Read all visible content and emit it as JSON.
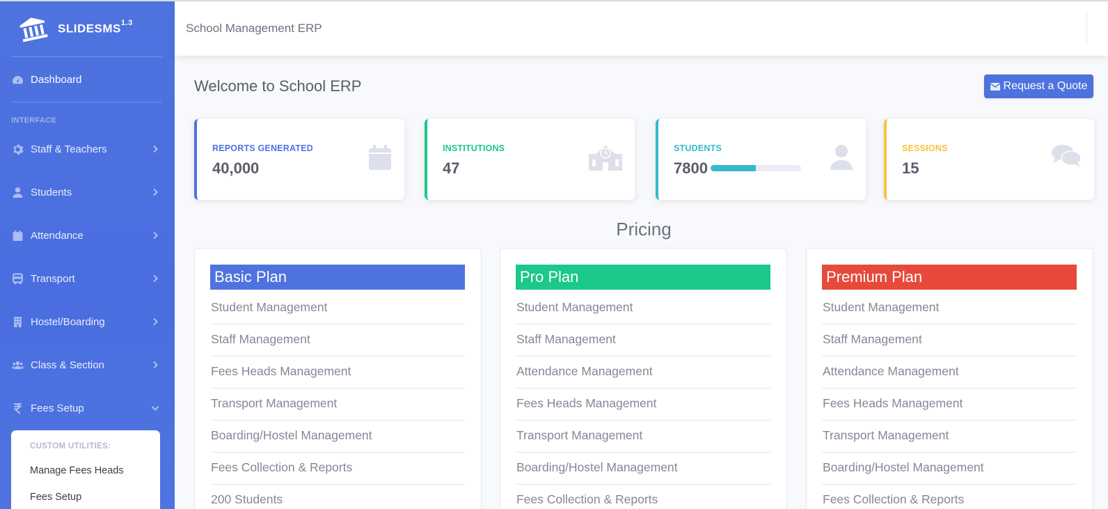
{
  "brand": {
    "name": "SLIDESMS",
    "version": "1.3"
  },
  "sidebar": {
    "dashboard": "Dashboard",
    "heading": "INTERFACE",
    "items": [
      {
        "label": "Staff & Teachers",
        "icon": "cog-icon"
      },
      {
        "label": "Students",
        "icon": "user-icon"
      },
      {
        "label": "Attendance",
        "icon": "calendar-icon"
      },
      {
        "label": "Transport",
        "icon": "bus-icon"
      },
      {
        "label": "Hostel/Boarding",
        "icon": "building-icon"
      },
      {
        "label": "Class & Section",
        "icon": "users-icon"
      },
      {
        "label": "Fees Setup",
        "icon": "rupee-icon",
        "expanded": true
      }
    ],
    "submenu": {
      "heading": "CUSTOM UTILITIES:",
      "items": [
        "Manage Fees Heads",
        "Fees Setup"
      ]
    }
  },
  "topbar": {
    "title": "School Management ERP"
  },
  "page": {
    "title": "Welcome to School ERP",
    "quote_button": "Request a Quote"
  },
  "stats": [
    {
      "label": "REPORTS GENERATED",
      "value": "40,000",
      "color": "#4e73df",
      "icon": "calendar-icon"
    },
    {
      "label": "INSTITUTIONS",
      "value": "47",
      "color": "#1cc88a",
      "icon": "school-icon"
    },
    {
      "label": "STUDENTS",
      "value": "7800",
      "color": "#36b9cc",
      "icon": "user-icon",
      "progress": 0.5
    },
    {
      "label": "SESSIONS",
      "value": "15",
      "color": "#f6c23e",
      "icon": "comments-icon"
    }
  ],
  "pricing": {
    "title": "Pricing",
    "plans": [
      {
        "name": "Basic Plan",
        "color": "#4e73df",
        "features": [
          "Student Management",
          "Staff Management",
          "Fees Heads Management",
          "Transport Management",
          "Boarding/Hostel Management",
          "Fees Collection & Reports",
          "200 Students"
        ]
      },
      {
        "name": "Pro Plan",
        "color": "#1cc88a",
        "features": [
          "Student Management",
          "Staff Management",
          "Attendance Management",
          "Fees Heads Management",
          "Transport Management",
          "Boarding/Hostel Management",
          "Fees Collection & Reports"
        ]
      },
      {
        "name": "Premium Plan",
        "color": "#e74a3b",
        "features": [
          "Student Management",
          "Staff Management",
          "Attendance Management",
          "Fees Heads Management",
          "Transport Management",
          "Boarding/Hostel Management",
          "Fees Collection & Reports"
        ]
      }
    ]
  }
}
